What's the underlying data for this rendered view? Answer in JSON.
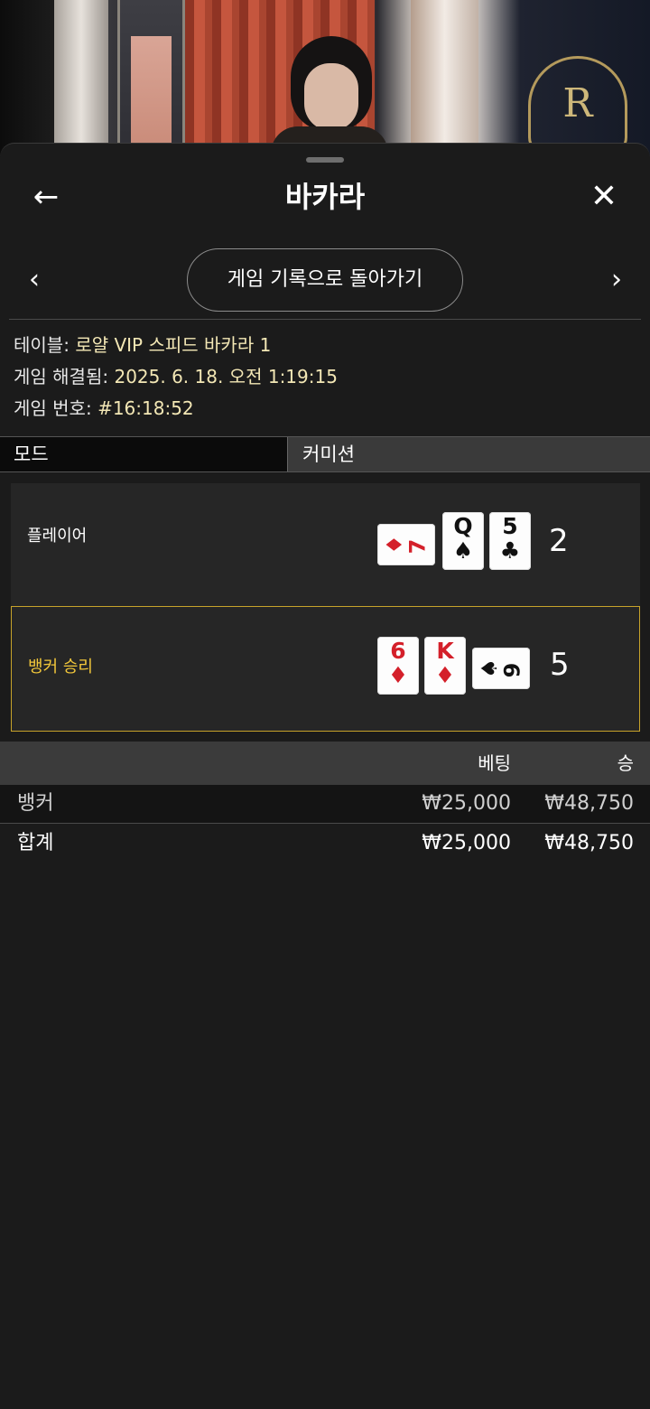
{
  "header": {
    "back_icon": "arrow-left-icon",
    "title": "바카라",
    "close_icon": "close-icon"
  },
  "nav": {
    "prev_icon": "chevron-left-icon",
    "next_icon": "chevron-right-icon",
    "back_to_history": "게임 기록으로 돌아가기"
  },
  "info": {
    "table_label": "테이블:",
    "table_value": "로얄 VIP 스피드 바카라 1",
    "resolved_label": "게임 해결됨:",
    "resolved_value": "2025. 6. 18. 오전 1:19:15",
    "number_label": "게임 번호:",
    "number_value": "#16:18:52"
  },
  "mode": {
    "label": "모드",
    "value": "커미션"
  },
  "hands": {
    "player": {
      "label": "플레이어",
      "score": "2",
      "cards": [
        {
          "rank": "7",
          "suit": "♦",
          "color": "#d4202a",
          "orientation": "sideways"
        },
        {
          "rank": "Q",
          "suit": "♠",
          "color": "#111111",
          "orientation": "upright"
        },
        {
          "rank": "5",
          "suit": "♣",
          "color": "#111111",
          "orientation": "upright"
        }
      ]
    },
    "banker": {
      "label": "뱅커 승리",
      "score": "5",
      "cards": [
        {
          "rank": "6",
          "suit": "♦",
          "color": "#d4202a",
          "orientation": "upright"
        },
        {
          "rank": "K",
          "suit": "♦",
          "color": "#d4202a",
          "orientation": "upright"
        },
        {
          "rank": "9",
          "suit": "♠",
          "color": "#111111",
          "orientation": "sideways"
        }
      ]
    }
  },
  "bets": {
    "col_bet": "베팅",
    "col_win": "승",
    "rows": [
      {
        "name": "뱅커",
        "bet": "₩25,000",
        "win": "₩48,750"
      }
    ],
    "total": {
      "name": "합계",
      "bet": "₩25,000",
      "win": "₩48,750"
    }
  },
  "colors": {
    "winner_accent": "#f2c73a",
    "panel_bg": "#1b1b1b",
    "info_value": "#f3e7b5"
  }
}
